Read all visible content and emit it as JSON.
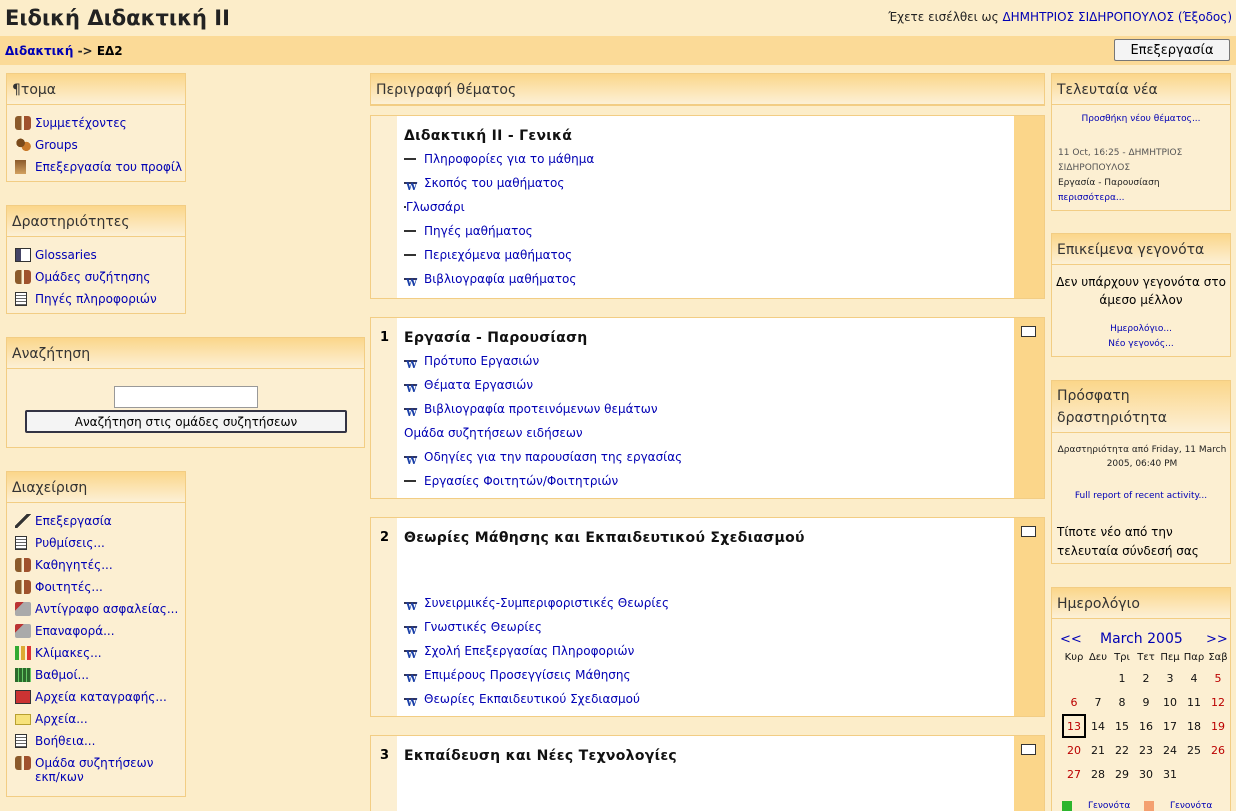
{
  "header": {
    "title": "Ειδική Διδακτική ΙΙ",
    "login_prefix": "Έχετε εισέλθει ως",
    "user": "ΔΗΜΗΤΡΙΟΣ ΣΙΔΗΡΟΠΟΥΛΟΣ",
    "logout": "(Έξοδος)"
  },
  "nav": {
    "home": "Διδακτική",
    "sep": "->",
    "current": "ΕΔ2",
    "edit_button": "Επεξεργασία"
  },
  "people": {
    "title": "¶τομα",
    "items": [
      {
        "label": "Συμμετέχοντες",
        "icon": "users-icon"
      },
      {
        "label": "Groups",
        "icon": "group-icon"
      },
      {
        "label": "Επεξεργασία του προφίλ",
        "icon": "profile-icon"
      }
    ]
  },
  "activities": {
    "title": "Δραστηριότητες",
    "items": [
      {
        "label": "Glossaries",
        "icon": "glossary-icon"
      },
      {
        "label": "Ομάδες συζήτησης",
        "icon": "forum-icon"
      },
      {
        "label": "Πηγές πληροφοριών",
        "icon": "resource-icon"
      }
    ]
  },
  "search": {
    "title": "Αναζήτηση",
    "value": "",
    "button": "Αναζήτηση στις ομάδες συζητήσεων"
  },
  "admin": {
    "title": "Διαχείριση",
    "items": [
      {
        "label": "Επεξεργασία",
        "icon": "edit-icon"
      },
      {
        "label": "Ρυθμίσεις...",
        "icon": "settings-icon"
      },
      {
        "label": "Καθηγητές...",
        "icon": "teachers-icon"
      },
      {
        "label": "Φοιτητές...",
        "icon": "students-icon"
      },
      {
        "label": "Αντίγραφο ασφαλείας...",
        "icon": "backup-icon"
      },
      {
        "label": "Επαναφορά...",
        "icon": "restore-icon"
      },
      {
        "label": "Κλίμακες...",
        "icon": "scales-icon"
      },
      {
        "label": "Βαθμοί...",
        "icon": "grades-icon"
      },
      {
        "label": "Αρχεία καταγραφής...",
        "icon": "logs-icon"
      },
      {
        "label": "Αρχεία...",
        "icon": "folder-icon"
      },
      {
        "label": "Βοήθεια...",
        "icon": "help-icon"
      },
      {
        "label": "Ομάδα συζητήσεων",
        "label2": "εκπ/κων",
        "icon": "forum-icon"
      }
    ]
  },
  "main": {
    "header": "Περιγραφή θέματος",
    "topics": [
      {
        "num": "",
        "title": "Διδακτική ΙΙ - Γενικά",
        "items": [
          {
            "label": "Πληροφορίες για το μάθημα",
            "icon": "doc"
          },
          {
            "label": "Σκοπός του μαθήματος",
            "icon": "wdoc"
          },
          {
            "label": "Γλωσσάρι",
            "icon": "gloss"
          },
          {
            "label": "Πηγές μαθήματος",
            "icon": "doc"
          },
          {
            "label": "Περιεχόμενα μαθήματος",
            "icon": "doc"
          },
          {
            "label": "Βιβλιογραφία μαθήματος",
            "icon": "wdoc"
          }
        ]
      },
      {
        "num": "1",
        "title": "Εργασία - Παρουσίαση",
        "items": [
          {
            "label": "Πρότυπο Εργασιών",
            "icon": "wdoc"
          },
          {
            "label": "Θέματα Εργασιών",
            "icon": "wdoc"
          },
          {
            "label": "Βιβλιογραφία προτεινόμενων θεμάτων",
            "icon": "wdoc"
          },
          {
            "label": "Ομάδα συζητήσεων ειδήσεων",
            "icon": "users"
          },
          {
            "label": "Οδηγίες για την παρουσίαση της εργασίας",
            "icon": "wdoc"
          },
          {
            "label": "Εργασίες Φοιτητών/Φοιτητριών",
            "icon": "doc"
          }
        ]
      },
      {
        "num": "2",
        "title": "Θεωρίες Μάθησης και Εκπαιδευτικού Σχεδιασμού",
        "items": [
          {
            "label": "Συνειρμικές-Συμπεριφοριστικές Θεωρίες",
            "icon": "wdoc"
          },
          {
            "label": "Γνωστικές Θεωρίες",
            "icon": "wdoc"
          },
          {
            "label": "Σχολή Επεξεργασίας Πληροφοριών",
            "icon": "wdoc"
          },
          {
            "label": "Επιμέρους Προσεγγίσεις Μάθησης",
            "icon": "wdoc"
          },
          {
            "label": "Θεωρίες Εκπαιδευτικού Σχεδιασμού",
            "icon": "wdoc"
          }
        ]
      },
      {
        "num": "3",
        "title": "Εκπαίδευση και Νέες Τεχνολογίες",
        "items": []
      }
    ]
  },
  "news": {
    "title": "Τελευταία νέα",
    "add": "Προσθήκη νέου θέματος...",
    "date": "11 Oct, 16:25 - ΔΗΜΗΤΡΙΟΣ",
    "author": "ΣΙΔΗΡΟΠΟΥΛΟΣ",
    "subject": "Εργασία - Παρουσίαση",
    "more": "περισσότερα..."
  },
  "events": {
    "title": "Επικείμενα γεγονότα",
    "none": "Δεν υπάρχουν γεγονότα στο άμεσο μέλλον",
    "calendar": "Ημερολόγιο...",
    "new_event": "Νέο γεγονός..."
  },
  "recent": {
    "title": "Πρόσφατη δραστηριότητα",
    "since": "Δραστηριότητα από Friday, 11 March 2005, 06:40 PM",
    "full": "Full report of recent activity...",
    "nothing": "Τίποτε νέο από την τελευταία σύνδεσή σας"
  },
  "calendar": {
    "title": "Ημερολόγιο",
    "prev": "<<",
    "next": ">>",
    "month": "March 2005",
    "days": [
      "Κυρ",
      "Δευ",
      "Τρι",
      "Τετ",
      "Πεμ",
      "Παρ",
      "Σαβ"
    ],
    "weeks": [
      [
        "",
        "",
        "1",
        "2",
        "3",
        "4",
        "5"
      ],
      [
        "6",
        "7",
        "8",
        "9",
        "10",
        "11",
        "12"
      ],
      [
        "13",
        "14",
        "15",
        "16",
        "17",
        "18",
        "19"
      ],
      [
        "20",
        "21",
        "22",
        "23",
        "24",
        "25",
        "26"
      ],
      [
        "27",
        "28",
        "29",
        "30",
        "31",
        "",
        ""
      ]
    ],
    "today": "13",
    "legend1": "Γενονότα",
    "legend2": "Γενονότα",
    "legend1_color": "#2db52d",
    "legend2_color": "#f4a070"
  }
}
